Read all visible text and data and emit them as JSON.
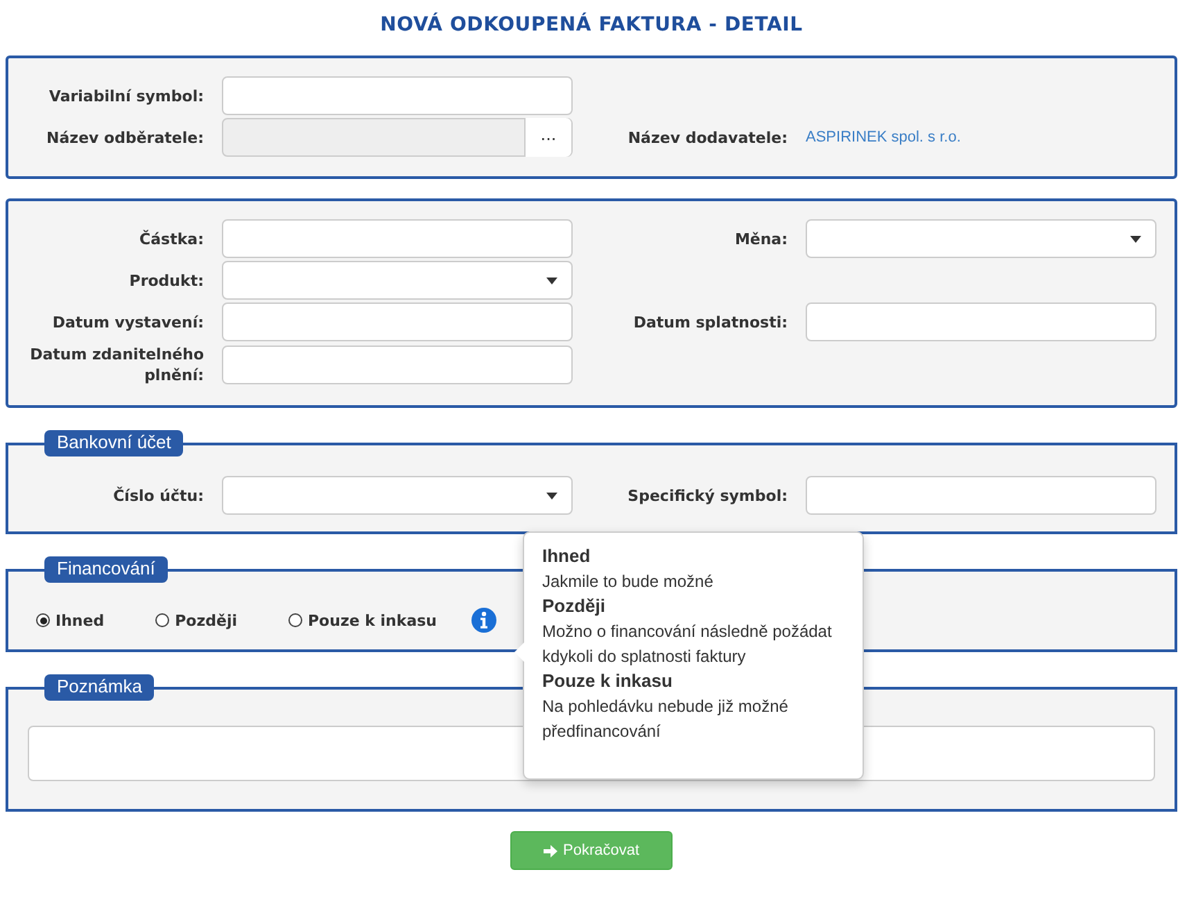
{
  "title": "NOVÁ ODKOUPENÁ FAKTURA - DETAIL",
  "sections": [
    {
      "rows": [
        [
          {
            "label": "Variabilní symbol:",
            "kind": "text",
            "disabled": false
          }
        ],
        [
          {
            "label": "Název odběratele:",
            "kind": "picker",
            "disabled": true,
            "button": "..."
          },
          {
            "label": "Název dodavatele:",
            "kind": "link",
            "value": "ASPIRINEK spol. s r.o."
          }
        ]
      ]
    },
    {
      "rows": [
        [
          {
            "label": "Částka:",
            "kind": "text",
            "disabled": false
          },
          {
            "label": "Měna:",
            "kind": "select",
            "disabled": false
          }
        ],
        [
          {
            "label": "Produkt:",
            "kind": "select",
            "disabled": false
          }
        ],
        [
          {
            "label": "Datum vystavení:",
            "kind": "text",
            "disabled": false
          },
          {
            "label": "Datum splatnosti:",
            "kind": "text",
            "disabled": false
          }
        ],
        [
          {
            "label": "Datum zdanitelného plnění:",
            "kind": "text",
            "disabled": false
          }
        ]
      ]
    },
    {
      "legend": "Bankovní účet",
      "rows": [
        [
          {
            "label": "Číslo účtu:",
            "kind": "select",
            "disabled": false
          },
          {
            "label": "Specifický symbol:",
            "kind": "text",
            "disabled": false
          }
        ]
      ]
    }
  ],
  "financing": {
    "legend": "Financování",
    "options": [
      {
        "label": "Ihned",
        "selected": true
      },
      {
        "label": "Později",
        "selected": false
      },
      {
        "label": "Pouze k inkasu",
        "selected": false
      }
    ]
  },
  "tooltip": [
    {
      "title": "Ihned",
      "text": "Jakmile to bude možné"
    },
    {
      "title": "Později",
      "text": "Možno o financování následně požádat kdykoli do splatnosti faktury"
    },
    {
      "title": "Pouze k inkasu",
      "text": "Na pohledávku nebude již možné předfinancování"
    }
  ],
  "note": {
    "legend": "Poznámka"
  },
  "submit": "Pokračovat"
}
